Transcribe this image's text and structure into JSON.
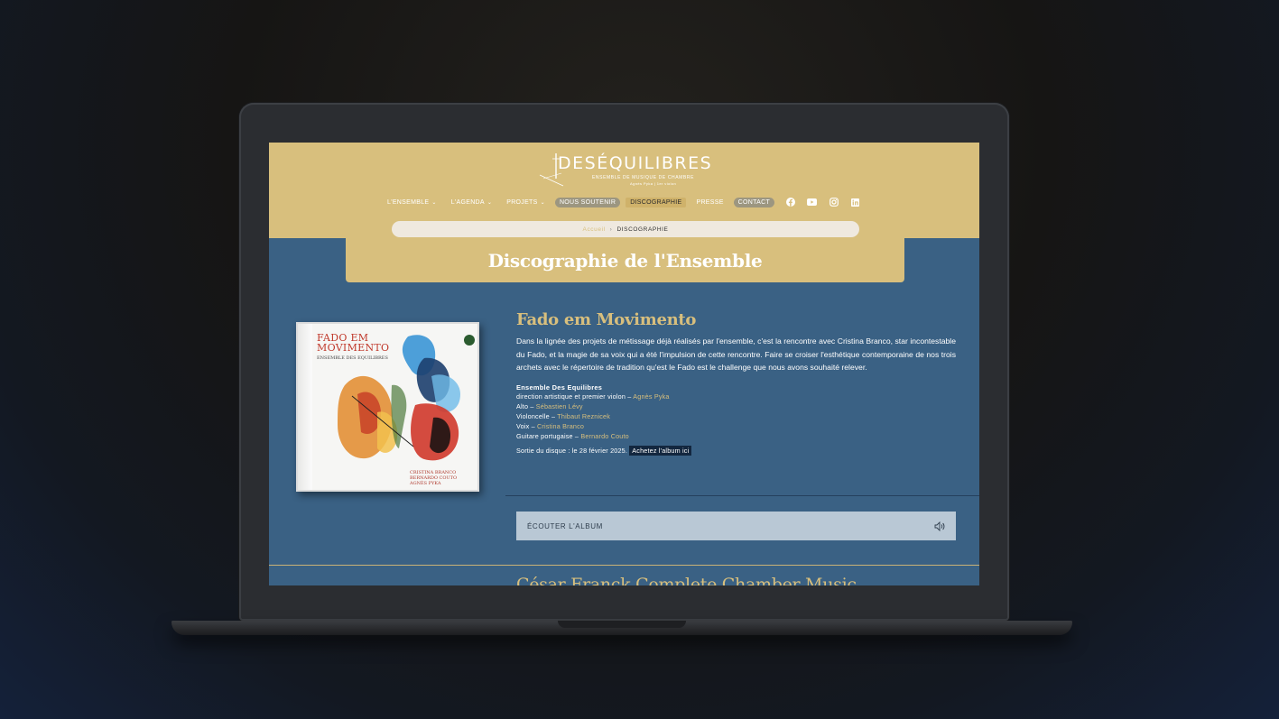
{
  "brand": {
    "name": "DESÉQUILIBRES",
    "tagline": "ENSEMBLE DE MUSIQUE DE CHAMBRE",
    "subline": "Agnès Pyka | 1er violon"
  },
  "nav": {
    "items": [
      {
        "label": "L'ENSEMBLE",
        "dropdown": true
      },
      {
        "label": "L'AGENDA",
        "dropdown": true
      },
      {
        "label": "PROJETS",
        "dropdown": true
      }
    ],
    "soutenir": "NOUS SOUTENIR",
    "discographie": "DISCOGRAPHIE",
    "presse": "PRESSE",
    "contact": "CONTACT",
    "social": [
      "facebook-icon",
      "youtube-icon",
      "instagram-icon",
      "linkedin-icon"
    ]
  },
  "breadcrumb": {
    "home": "Accueil",
    "separator": "›",
    "current": "DISCOGRAPHIE"
  },
  "page": {
    "title": "Discographie de l'Ensemble"
  },
  "album": {
    "cover": {
      "title_line1": "FADO EM",
      "title_line2": "MOVIMENTO",
      "subtitle": "ENSEMBLE DES EQUILIBRES",
      "credit1": "CRISTINA BRANCO",
      "credit2": "BERNARDO COUTO",
      "credit3": "AGNÈS PYKA"
    },
    "title": "Fado em Movimento",
    "description": "Dans la lignée des projets de métissage déjà réalisés par l'ensemble, c'est la rencontre avec Cristina Branco, star incontestable du Fado, et la magie de sa voix qui a été l'impulsion de cette rencontre. Faire se croiser l'esthétique contemporaine de nos trois archets avec le répertoire de tradition qu'est le Fado est le challenge que nous avons souhaité relever.",
    "ensemble_name": "Ensemble Des Equilibres",
    "credits": [
      {
        "role": "direction artistique et premier violon  – ",
        "person": "Agnès Pyka"
      },
      {
        "role": "Alto – ",
        "person": "Sébastien Lévy"
      },
      {
        "role": "Violoncelle – ",
        "person": "Thibaut Reznicek"
      },
      {
        "role": "Voix – ",
        "person": "Cristina Branco"
      },
      {
        "role": "Guitare portugaise – ",
        "person": "Bernardo Couto"
      }
    ],
    "release_text": "Sortie du disque : le 28 février 2025. ",
    "buy_label": "Achetez l'album ici",
    "listen_label": "ÉCOUTER L'ALBUM"
  },
  "next_album": {
    "title": "César Franck Complete Chamber Music"
  },
  "colors": {
    "gold": "#d8bf7d",
    "blue": "#3a6184",
    "navy": "#13273f"
  }
}
